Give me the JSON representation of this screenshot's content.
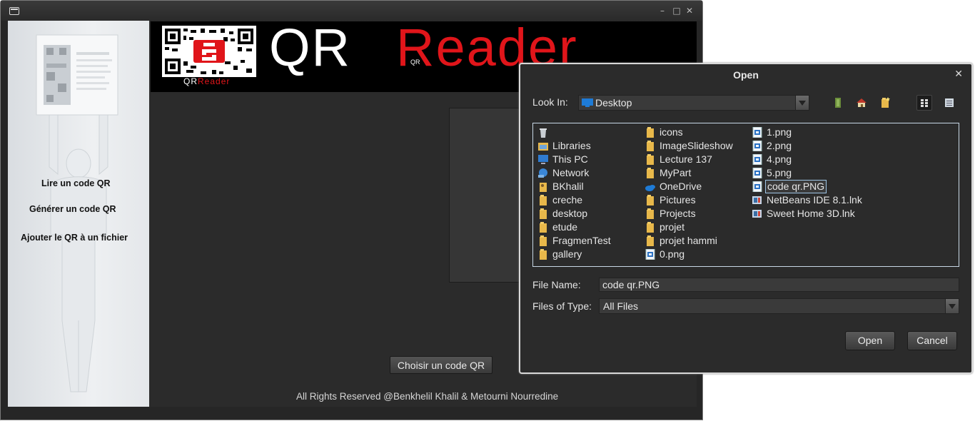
{
  "main_window": {
    "sidebar": {
      "read_qr": "Lire un code QR",
      "generate_qr": "Générer un code QR",
      "add_qr_to_file": "Ajouter le QR à un fichier"
    },
    "banner": {
      "qr_text": "QR",
      "small_text": "QR",
      "reader_text": "Reader",
      "logo_caption_qr": "QR",
      "logo_caption_reader": "Reader"
    },
    "choose_button": "Choisir un code QR",
    "footer": "All Rights Reserved @Benkhelil Khalil & Metourni Nourredine",
    "colors": {
      "accent_red": "#e0151a",
      "background": "#2b2b2b"
    }
  },
  "dialog": {
    "title": "Open",
    "look_in_label": "Look In:",
    "look_in_value": "Desktop",
    "file_name_label": "File Name:",
    "file_name_value": "code qr.PNG",
    "files_of_type_label": "Files of Type:",
    "files_of_type_value": "All Files",
    "open_button": "Open",
    "cancel_button": "Cancel",
    "toolbar_icons": [
      "up-one-level-icon",
      "home-icon",
      "new-folder-icon",
      "list-view-icon",
      "details-view-icon"
    ],
    "files": {
      "col1": [
        {
          "name": "",
          "icon": "recycle-bin-icon"
        },
        {
          "name": "Libraries",
          "icon": "libraries-icon"
        },
        {
          "name": "This PC",
          "icon": "computer-icon"
        },
        {
          "name": "Network",
          "icon": "network-icon"
        },
        {
          "name": "BKhalil",
          "icon": "user-folder-icon"
        },
        {
          "name": "creche",
          "icon": "folder-icon"
        },
        {
          "name": "desktop",
          "icon": "folder-icon"
        },
        {
          "name": "etude",
          "icon": "folder-icon"
        },
        {
          "name": "FragmenTest",
          "icon": "folder-icon"
        },
        {
          "name": "gallery",
          "icon": "folder-icon"
        }
      ],
      "col2": [
        {
          "name": "icons",
          "icon": "folder-icon"
        },
        {
          "name": "ImageSlideshow",
          "icon": "folder-icon"
        },
        {
          "name": "Lecture 137",
          "icon": "folder-icon"
        },
        {
          "name": "MyPart",
          "icon": "folder-icon"
        },
        {
          "name": "OneDrive",
          "icon": "onedrive-icon"
        },
        {
          "name": "Pictures",
          "icon": "folder-icon"
        },
        {
          "name": "Projects",
          "icon": "folder-icon"
        },
        {
          "name": "projet",
          "icon": "folder-icon"
        },
        {
          "name": "projet hammi",
          "icon": "folder-icon"
        },
        {
          "name": "0.png",
          "icon": "image-file-icon"
        }
      ],
      "col3": [
        {
          "name": "1.png",
          "icon": "image-file-icon"
        },
        {
          "name": "2.png",
          "icon": "image-file-icon"
        },
        {
          "name": "4.png",
          "icon": "image-file-icon"
        },
        {
          "name": "5.png",
          "icon": "image-file-icon"
        },
        {
          "name": "code qr.PNG",
          "icon": "image-file-icon",
          "selected": true
        },
        {
          "name": "NetBeans IDE 8.1.lnk",
          "icon": "shortcut-icon"
        },
        {
          "name": "Sweet Home 3D.lnk",
          "icon": "shortcut-icon"
        }
      ]
    }
  }
}
